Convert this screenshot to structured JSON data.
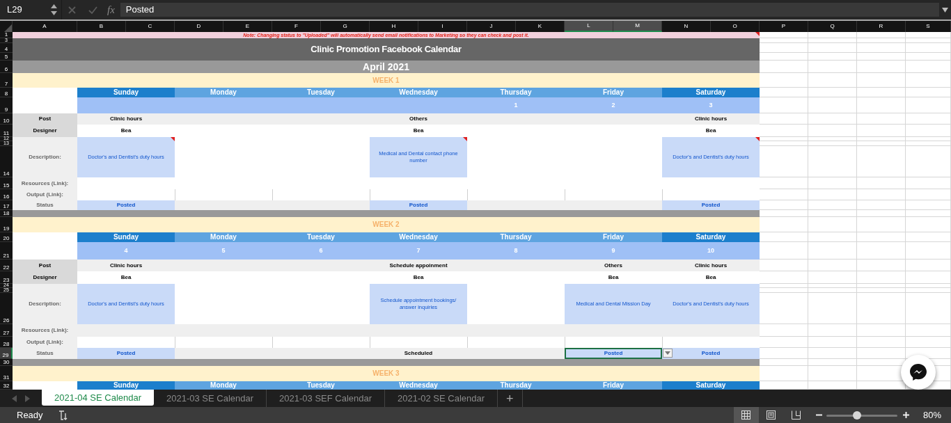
{
  "formula_bar": {
    "cell_ref": "L29",
    "function_label": "fx",
    "formula": "Posted"
  },
  "columns": [
    {
      "label": "A",
      "selected": false
    },
    {
      "label": "B",
      "selected": false
    },
    {
      "label": "C",
      "selected": false
    },
    {
      "label": "D",
      "selected": false
    },
    {
      "label": "E",
      "selected": false
    },
    {
      "label": "F",
      "selected": false
    },
    {
      "label": "G",
      "selected": false
    },
    {
      "label": "H",
      "selected": false
    },
    {
      "label": "I",
      "selected": false
    },
    {
      "label": "J",
      "selected": false
    },
    {
      "label": "K",
      "selected": false
    },
    {
      "label": "L",
      "selected": true
    },
    {
      "label": "M",
      "selected": true
    },
    {
      "label": "N",
      "selected": false
    },
    {
      "label": "O",
      "selected": false
    },
    {
      "label": "P",
      "selected": false
    },
    {
      "label": "Q",
      "selected": false
    },
    {
      "label": "R",
      "selected": false
    },
    {
      "label": "S",
      "selected": false
    }
  ],
  "rows": [
    {
      "label": "1",
      "selected": false
    },
    {
      "label": "3",
      "selected": false
    },
    {
      "label": "4",
      "selected": false
    },
    {
      "label": "5",
      "selected": false
    },
    {
      "label": "6",
      "selected": false
    },
    {
      "label": "7",
      "selected": false
    },
    {
      "label": "8",
      "selected": false
    },
    {
      "label": "9",
      "selected": false
    },
    {
      "label": "10",
      "selected": false
    },
    {
      "label": "11",
      "selected": false
    },
    {
      "label": "12",
      "selected": false
    },
    {
      "label": "13",
      "selected": false
    },
    {
      "label": "14",
      "selected": false
    },
    {
      "label": "15",
      "selected": false
    },
    {
      "label": "16",
      "selected": false
    },
    {
      "label": "17",
      "selected": false
    },
    {
      "label": "18",
      "selected": false
    },
    {
      "label": "19",
      "selected": false
    },
    {
      "label": "20",
      "selected": false
    },
    {
      "label": "21",
      "selected": false
    },
    {
      "label": "22",
      "selected": false
    },
    {
      "label": "23",
      "selected": false
    },
    {
      "label": "24",
      "selected": false
    },
    {
      "label": "25",
      "selected": false
    },
    {
      "label": "26",
      "selected": false
    },
    {
      "label": "27",
      "selected": false
    },
    {
      "label": "28",
      "selected": false
    },
    {
      "label": "29",
      "selected": true
    },
    {
      "label": "30",
      "selected": false
    },
    {
      "label": "31",
      "selected": false
    },
    {
      "label": "32",
      "selected": false
    }
  ],
  "note": {
    "text": "Note: Changing status to \"Uploaded\" will automatically send email notifications to Marketing so they can check and post it.",
    "comment": true
  },
  "title": "Clinic Promotion Facebook Calendar",
  "month": "April 2021",
  "weeks": [
    {
      "title": "WEEK 1",
      "labels": {
        "post": "Post",
        "designer": "Designer",
        "description": "Description:",
        "resources": "Resources (Link):",
        "output": "Output (Link):",
        "status": "Status"
      },
      "days": [
        {
          "name": "Sunday",
          "weekend": true,
          "post": "Clinic hours",
          "designer": "Bea",
          "description": "Doctor's and Dentist's duty hours",
          "comment": true,
          "status": "Posted",
          "highlighted": true,
          "status_selected": false
        },
        {
          "name": "Monday",
          "weekend": false
        },
        {
          "name": "Tuesday",
          "weekend": false
        },
        {
          "name": "Wednesday",
          "weekend": false,
          "post": "Others",
          "designer": "Bea",
          "description": "Medical and Dental contact phone number",
          "comment": true,
          "status": "Posted",
          "highlighted": true,
          "status_selected": false
        },
        {
          "name": "Thursday",
          "weekend": false,
          "date": "1"
        },
        {
          "name": "Friday",
          "weekend": false,
          "date": "2"
        },
        {
          "name": "Saturday",
          "weekend": true,
          "date": "3",
          "post": "Clinic hours",
          "designer": "Bea",
          "description": "Doctor's and Dentist's duty hours",
          "comment": true,
          "status": "Posted",
          "highlighted": true,
          "status_selected": false
        }
      ]
    },
    {
      "title": "WEEK 2",
      "labels": {
        "post": "Post",
        "designer": "Designer",
        "description": "Description:",
        "resources": "Resources (Link):",
        "output": "Output (Link):",
        "status": "Status"
      },
      "days": [
        {
          "name": "Sunday",
          "weekend": true,
          "date": "4",
          "post": "Clinic hours",
          "designer": "Bea",
          "description": "Doctor's and Dentist's duty hours",
          "status": "Posted",
          "highlighted": true,
          "status_selected": false
        },
        {
          "name": "Monday",
          "weekend": false,
          "date": "5"
        },
        {
          "name": "Tuesday",
          "weekend": false,
          "date": "6"
        },
        {
          "name": "Wednesday",
          "weekend": false,
          "date": "7",
          "post": "Schedule appoinment",
          "designer": "Bea",
          "description": "Schedule appointment bookings/ answer inquiries",
          "status": "Scheduled",
          "highlighted": false,
          "status_selected": false
        },
        {
          "name": "Thursday",
          "weekend": false,
          "date": "8"
        },
        {
          "name": "Friday",
          "weekend": false,
          "date": "9",
          "post": "Others",
          "designer": "Bea",
          "description": "Medical and Dental Mission Day",
          "status": "Posted",
          "highlighted": true,
          "status_selected": true
        },
        {
          "name": "Saturday",
          "weekend": true,
          "date": "10",
          "post": "Clinic hours",
          "designer": "Bea",
          "description": "Doctor's and Dentist's duty hours",
          "status": "Posted",
          "highlighted": true,
          "status_selected": false
        }
      ]
    },
    {
      "title": "WEEK 3",
      "days": [
        {
          "name": "Sunday",
          "weekend": true
        },
        {
          "name": "Monday",
          "weekend": false
        },
        {
          "name": "Tuesday",
          "weekend": false
        },
        {
          "name": "Wednesday",
          "weekend": false
        },
        {
          "name": "Thursday",
          "weekend": false
        },
        {
          "name": "Friday",
          "weekend": false
        },
        {
          "name": "Saturday",
          "weekend": true
        }
      ]
    }
  ],
  "sheet_tabs": [
    {
      "label": "2021-04 SE Calendar",
      "selected": true
    },
    {
      "label": "2021-03 SE Calendar",
      "selected": false
    },
    {
      "label": "2021-03 SEF Calendar",
      "selected": false
    },
    {
      "label": "2021-02 SE Calendar",
      "selected": false
    }
  ],
  "add_sheet": "+",
  "status_bar": {
    "status": "Ready",
    "views": [
      {
        "kind": "normal",
        "selected": true
      },
      {
        "kind": "page-layout",
        "selected": false
      },
      {
        "kind": "page-break",
        "selected": false
      }
    ],
    "zoom": {
      "level": 0.43,
      "reading": "80%"
    }
  }
}
